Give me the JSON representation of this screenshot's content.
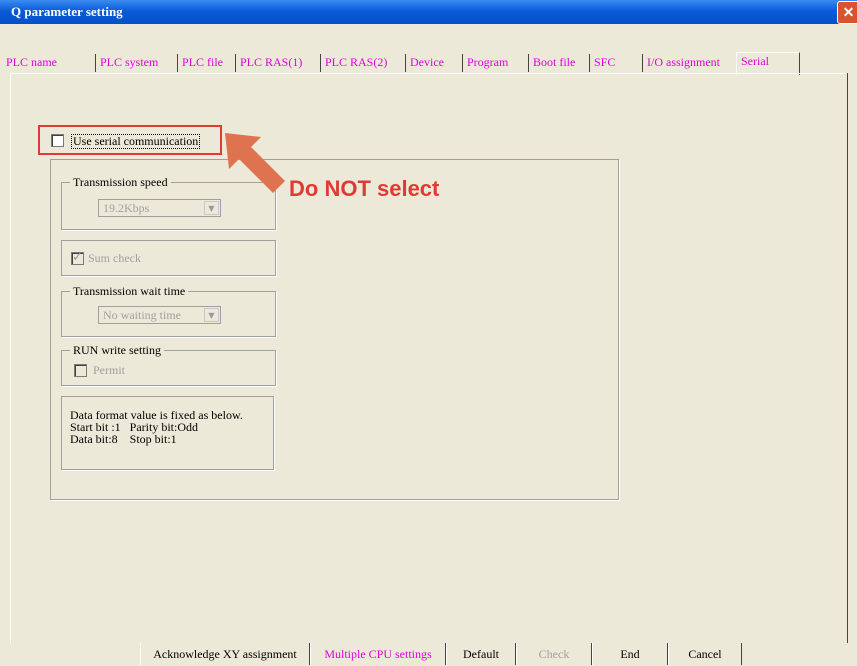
{
  "window": {
    "title": "Q parameter setting",
    "close_icon": "close-icon"
  },
  "tabs": [
    {
      "label": "PLC name"
    },
    {
      "label": "PLC system"
    },
    {
      "label": "PLC file"
    },
    {
      "label": "PLC RAS(1)"
    },
    {
      "label": "PLC RAS(2)"
    },
    {
      "label": "Device"
    },
    {
      "label": "Program"
    },
    {
      "label": "Boot file"
    },
    {
      "label": "SFC"
    },
    {
      "label": "I/O assignment"
    },
    {
      "label": "Serial",
      "active": true
    }
  ],
  "serial": {
    "use_serial_label": "Use serial communication",
    "use_serial_checked": false,
    "transmission_speed": {
      "legend": "Transmission speed",
      "value": "19.2Kbps"
    },
    "sum_check": {
      "label": "Sum check",
      "checked": true
    },
    "wait_time": {
      "legend": "Transmission wait time",
      "value": "No waiting time"
    },
    "run_write": {
      "legend": "RUN write setting",
      "permit_label": "Permit",
      "checked": false
    },
    "data_format": {
      "line1": "Data format value is fixed as below.",
      "line2": "Start bit :1   Parity bit:Odd",
      "line3": "Data bit:8    Stop bit:1"
    }
  },
  "annotation": {
    "text": "Do NOT select",
    "color": "#e13a32"
  },
  "buttons": {
    "acknowledge": "Acknowledge XY assignment",
    "multiple_cpu": "Multiple CPU settings",
    "default": "Default",
    "check": "Check",
    "end": "End",
    "cancel": "Cancel"
  },
  "colors": {
    "titlebar": "#0a5bd9",
    "tab_text": "#e000e0",
    "background": "#ece9d8"
  }
}
